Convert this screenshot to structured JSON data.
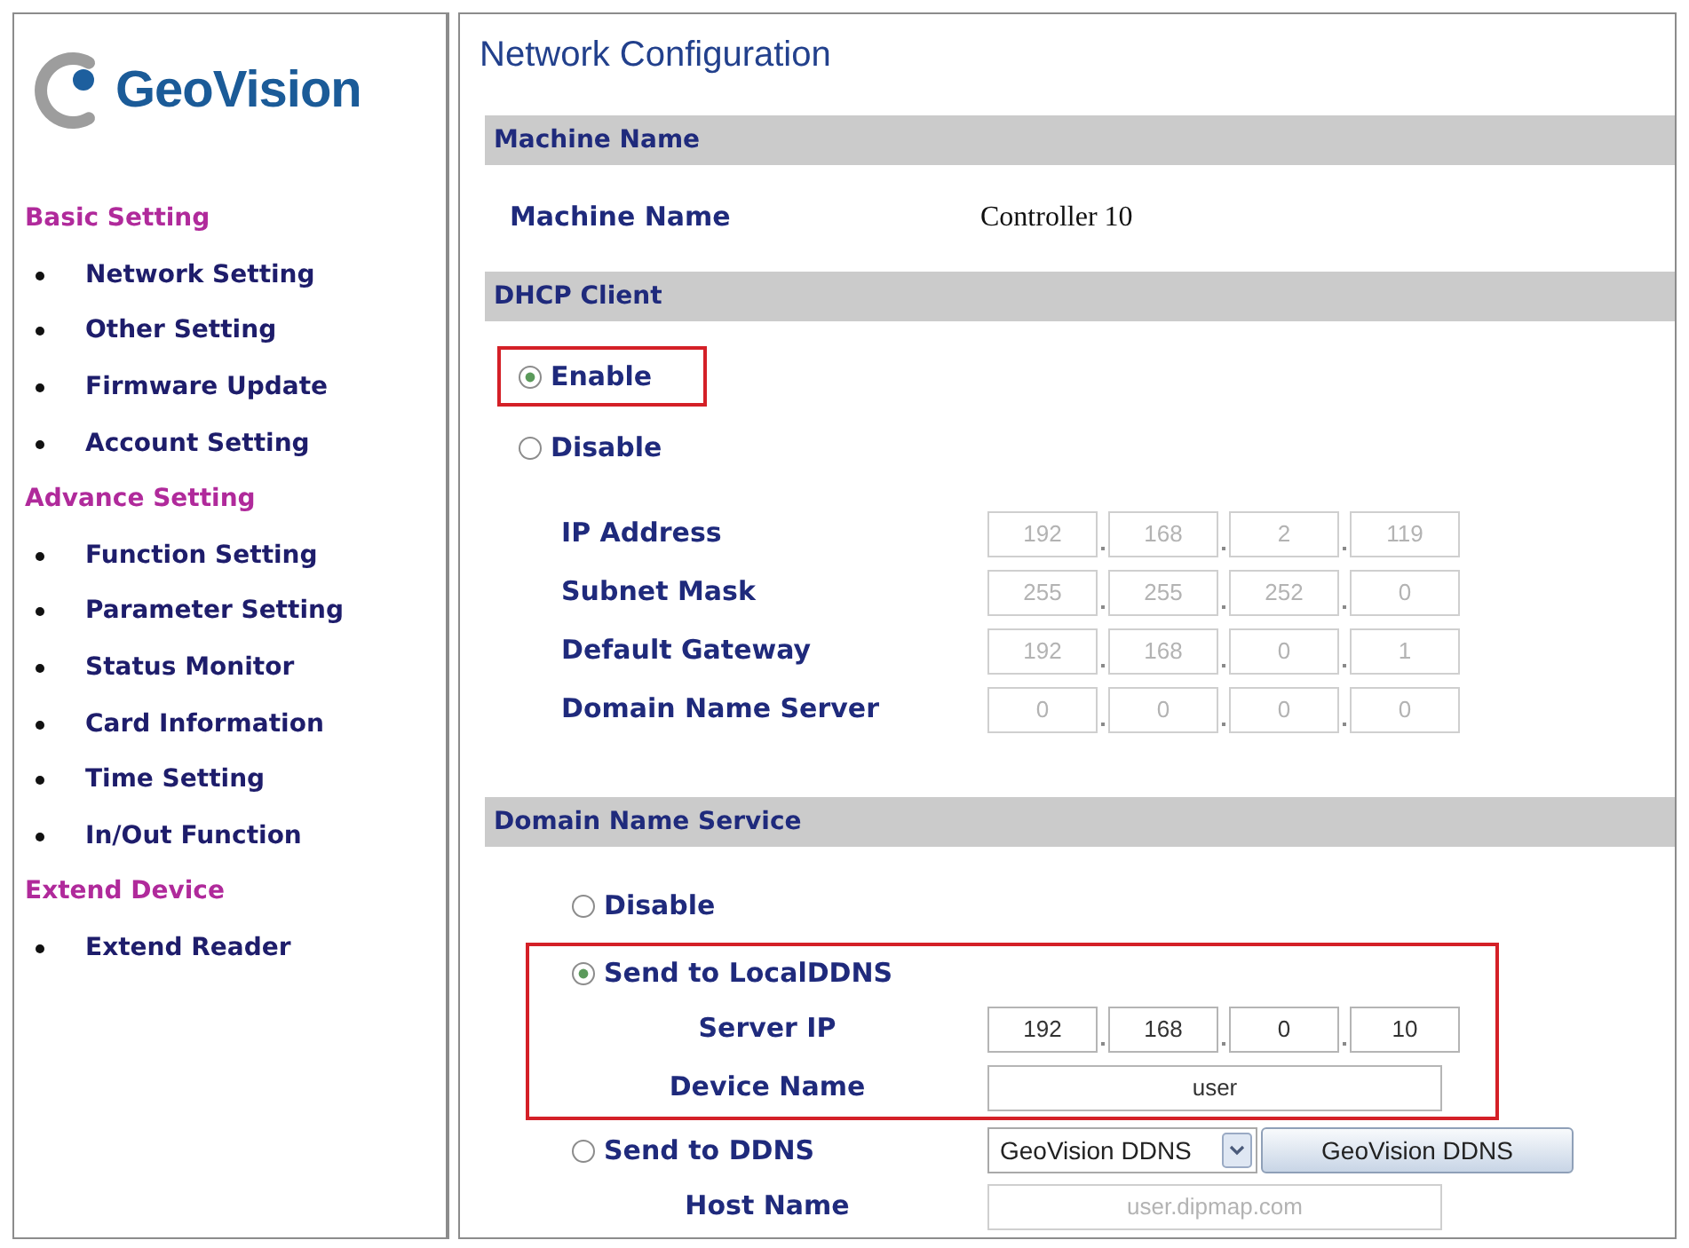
{
  "logo": {
    "text": "GeoVision"
  },
  "sidebar": {
    "groups": [
      {
        "title": "Basic Setting",
        "items": [
          {
            "label": "Network Setting"
          },
          {
            "label": "Other Setting"
          },
          {
            "label": "Firmware Update"
          },
          {
            "label": "Account Setting"
          }
        ]
      },
      {
        "title": "Advance Setting",
        "items": [
          {
            "label": "Function Setting"
          },
          {
            "label": "Parameter Setting"
          },
          {
            "label": "Status Monitor"
          },
          {
            "label": "Card Information"
          },
          {
            "label": "Time Setting"
          },
          {
            "label": "In/Out Function"
          }
        ]
      },
      {
        "title": "Extend Device",
        "items": [
          {
            "label": "Extend Reader"
          }
        ]
      }
    ]
  },
  "page_title": "Network Configuration",
  "sections": [
    {
      "kind": "info",
      "title": "Machine Name",
      "rows": [
        {
          "kind": "text",
          "label": "Machine Name",
          "value": "Controller 10"
        }
      ]
    },
    {
      "kind": "dhcp",
      "title": "DHCP Client",
      "rows": [
        {
          "kind": "radio",
          "label": "Enable",
          "selected": true,
          "highlighted": true
        },
        {
          "kind": "radio",
          "label": "Disable",
          "selected": false,
          "highlighted": false
        },
        {
          "kind": "ip",
          "label": "IP Address",
          "disabled": true,
          "octets": [
            "192",
            "168",
            "2",
            "119"
          ]
        },
        {
          "kind": "ip",
          "label": "Subnet Mask",
          "disabled": true,
          "octets": [
            "255",
            "255",
            "252",
            "0"
          ]
        },
        {
          "kind": "ip",
          "label": "Default Gateway",
          "disabled": true,
          "octets": [
            "192",
            "168",
            "0",
            "1"
          ]
        },
        {
          "kind": "ip",
          "label": "Domain Name Server",
          "disabled": true,
          "octets": [
            "0",
            "0",
            "0",
            "0"
          ]
        }
      ]
    },
    {
      "kind": "dns",
      "title": "Domain Name Service",
      "rows": [
        {
          "kind": "radio",
          "label": "Disable",
          "selected": false,
          "highlighted": false
        },
        {
          "kind": "radio",
          "label": "Send to LocalDDNS",
          "selected": true,
          "highlighted": true,
          "children": [
            {
              "kind": "ip",
              "label": "Server IP",
              "disabled": false,
              "octets": [
                "192",
                "168",
                "0",
                "10"
              ]
            },
            {
              "kind": "field",
              "label": "Device Name",
              "disabled": false,
              "value": "user"
            }
          ]
        },
        {
          "kind": "radio",
          "label": "Send to DDNS",
          "selected": false,
          "highlighted": false,
          "select": {
            "value": "GeoVision DDNS"
          },
          "button": {
            "label": "GeoVision DDNS"
          },
          "children": [
            {
              "kind": "field",
              "label": "Host Name",
              "disabled": true,
              "value": "user.dipmap.com"
            }
          ]
        }
      ]
    }
  ]
}
